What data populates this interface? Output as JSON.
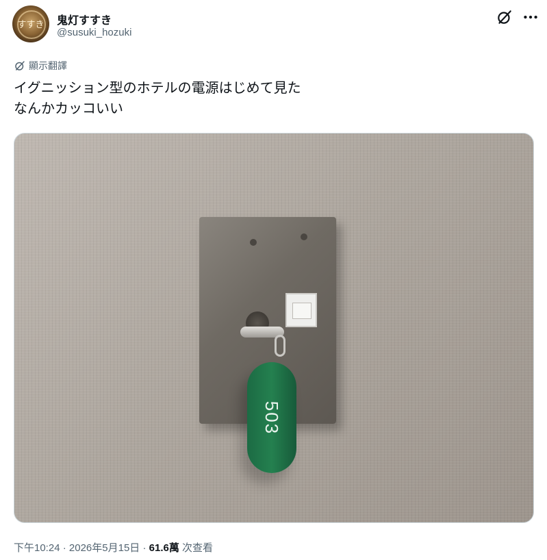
{
  "header": {
    "display_name": "鬼灯すすき",
    "handle": "@susuki_hozuki",
    "avatar_text": "すすき",
    "icons": [
      "grok-icon",
      "more-icon"
    ]
  },
  "translate": {
    "label": "顯示翻譯",
    "icon": "translate-globe-icon"
  },
  "tweet": {
    "lines": [
      "イグニッション型のホテルの電源はじめて見た",
      "なんかカッコいい"
    ]
  },
  "photo": {
    "key_tag_number": "503"
  },
  "meta": {
    "time": "下午10:24",
    "separator": "·",
    "date": "2026年5月15日",
    "views": "61.6萬",
    "views_label": "次查看"
  },
  "colors": {
    "text_primary": "#0f1419",
    "text_secondary": "#536471",
    "border": "#cfd9de",
    "fob_green": "#24804f"
  }
}
